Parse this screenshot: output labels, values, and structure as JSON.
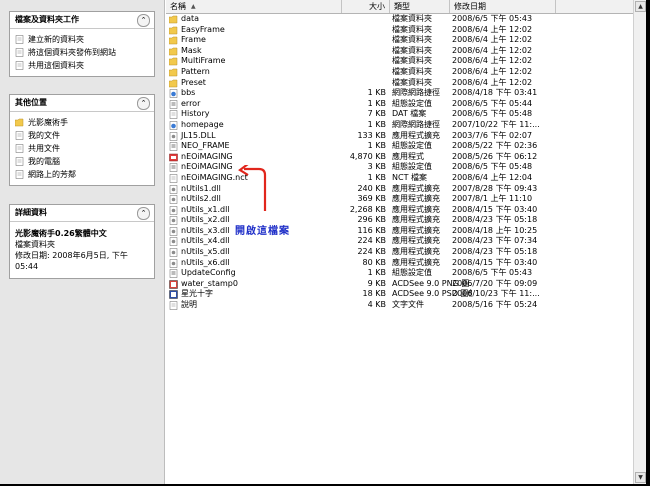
{
  "taskpane": {
    "file_tasks": {
      "title": "檔案及資料夾工作",
      "items": [
        "建立新的資料夾",
        "將這個資料夾發佈到網站",
        "共用這個資料夾"
      ]
    },
    "other_places": {
      "title": "其他位置",
      "items": [
        "光影魔術手",
        "我的文件",
        "共用文件",
        "我的電腦",
        "網路上的芳鄰"
      ]
    },
    "details": {
      "title": "詳細資料",
      "name": "光影魔術手0.26繁體中文",
      "kind": "檔案資料夾",
      "modified": "修改日期: 2008年6月5日, 下午 05:44"
    }
  },
  "columns": {
    "name": "名稱",
    "size": "大小",
    "type": "類型",
    "date": "修改日期"
  },
  "files": [
    {
      "icon": "folder-icon",
      "name": "data",
      "size": "",
      "type": "檔案資料夾",
      "date": "2008/6/5 下午 05:43"
    },
    {
      "icon": "folder-icon",
      "name": "EasyFrame",
      "size": "",
      "type": "檔案資料夾",
      "date": "2008/6/4 上午 12:02"
    },
    {
      "icon": "folder-icon",
      "name": "Frame",
      "size": "",
      "type": "檔案資料夾",
      "date": "2008/6/4 上午 12:02"
    },
    {
      "icon": "folder-icon",
      "name": "Mask",
      "size": "",
      "type": "檔案資料夾",
      "date": "2008/6/4 上午 12:02"
    },
    {
      "icon": "folder-icon",
      "name": "MultiFrame",
      "size": "",
      "type": "檔案資料夾",
      "date": "2008/6/4 上午 12:02"
    },
    {
      "icon": "folder-icon",
      "name": "Pattern",
      "size": "",
      "type": "檔案資料夾",
      "date": "2008/6/4 上午 12:02"
    },
    {
      "icon": "folder-icon",
      "name": "Preset",
      "size": "",
      "type": "檔案資料夾",
      "date": "2008/6/4 上午 12:02"
    },
    {
      "icon": "internet-shortcut-icon",
      "name": "bbs",
      "size": "1 KB",
      "type": "網際網路捷徑",
      "date": "2008/4/18 下午 03:41"
    },
    {
      "icon": "config-file-icon",
      "name": "error",
      "size": "1 KB",
      "type": "組態設定值",
      "date": "2008/6/5 下午 05:44"
    },
    {
      "icon": "dat-file-icon",
      "name": "History",
      "size": "7 KB",
      "type": "DAT 檔案",
      "date": "2008/6/5 下午 05:48"
    },
    {
      "icon": "internet-shortcut-icon",
      "name": "homepage",
      "size": "1 KB",
      "type": "網際網路捷徑",
      "date": "2007/10/22 下午 11:..."
    },
    {
      "icon": "dll-file-icon",
      "name": "JL15.DLL",
      "size": "133 KB",
      "type": "應用程式擴充",
      "date": "2003/7/6 下午 02:07"
    },
    {
      "icon": "config-file-icon",
      "name": "NEO_FRAME",
      "size": "1 KB",
      "type": "組態設定值",
      "date": "2008/5/22 下午 02:36"
    },
    {
      "icon": "app-icon",
      "name": "nEOiMAGING",
      "size": "4,870 KB",
      "type": "應用程式",
      "date": "2008/5/26 下午 06:12"
    },
    {
      "icon": "config-file-icon",
      "name": "nEOiMAGING",
      "size": "3 KB",
      "type": "組態設定值",
      "date": "2008/6/5 下午 05:48"
    },
    {
      "icon": "nct-file-icon",
      "name": "nEOiMAGING.nct",
      "size": "1 KB",
      "type": "NCT 檔案",
      "date": "2008/6/4 上午 12:04"
    },
    {
      "icon": "dll-file-icon",
      "name": "nUtils1.dll",
      "size": "240 KB",
      "type": "應用程式擴充",
      "date": "2007/8/28 下午 09:43"
    },
    {
      "icon": "dll-file-icon",
      "name": "nUtils2.dll",
      "size": "369 KB",
      "type": "應用程式擴充",
      "date": "2007/8/1 上午 11:10"
    },
    {
      "icon": "dll-file-icon",
      "name": "nUtils_x1.dll",
      "size": "2,268 KB",
      "type": "應用程式擴充",
      "date": "2008/4/15 下午 03:40"
    },
    {
      "icon": "dll-file-icon",
      "name": "nUtils_x2.dll",
      "size": "296 KB",
      "type": "應用程式擴充",
      "date": "2008/4/23 下午 05:18"
    },
    {
      "icon": "dll-file-icon",
      "name": "nUtils_x3.dll",
      "size": "116 KB",
      "type": "應用程式擴充",
      "date": "2008/4/18 上午 10:25"
    },
    {
      "icon": "dll-file-icon",
      "name": "nUtils_x4.dll",
      "size": "224 KB",
      "type": "應用程式擴充",
      "date": "2008/4/23 下午 07:34"
    },
    {
      "icon": "dll-file-icon",
      "name": "nUtils_x5.dll",
      "size": "224 KB",
      "type": "應用程式擴充",
      "date": "2008/4/23 下午 05:18"
    },
    {
      "icon": "dll-file-icon",
      "name": "nUtils_x6.dll",
      "size": "80 KB",
      "type": "應用程式擴充",
      "date": "2008/4/15 下午 03:40"
    },
    {
      "icon": "config-file-icon",
      "name": "UpdateConfig",
      "size": "1 KB",
      "type": "組態設定值",
      "date": "2008/6/5 下午 05:43"
    },
    {
      "icon": "png-image-icon",
      "name": "water_stamp0",
      "size": "9 KB",
      "type": "ACDSee 9.0 PNG 圖...",
      "date": "2006/7/20 下午 09:09"
    },
    {
      "icon": "psd-image-icon",
      "name": "星光十字",
      "size": "18 KB",
      "type": "ACDSee 9.0 PSD 圖像",
      "date": "2006/10/23 下午 11:..."
    },
    {
      "icon": "text-file-icon",
      "name": "說明",
      "size": "4 KB",
      "type": "文字文件",
      "date": "2008/5/16 下午 05:24"
    }
  ],
  "annotation": {
    "text": "開啟這檔案",
    "color": "#1f2fc8"
  },
  "colors": {
    "folder": "#f2c94c",
    "selection": "#3d6ec9",
    "pane": "#e6e6e6"
  }
}
